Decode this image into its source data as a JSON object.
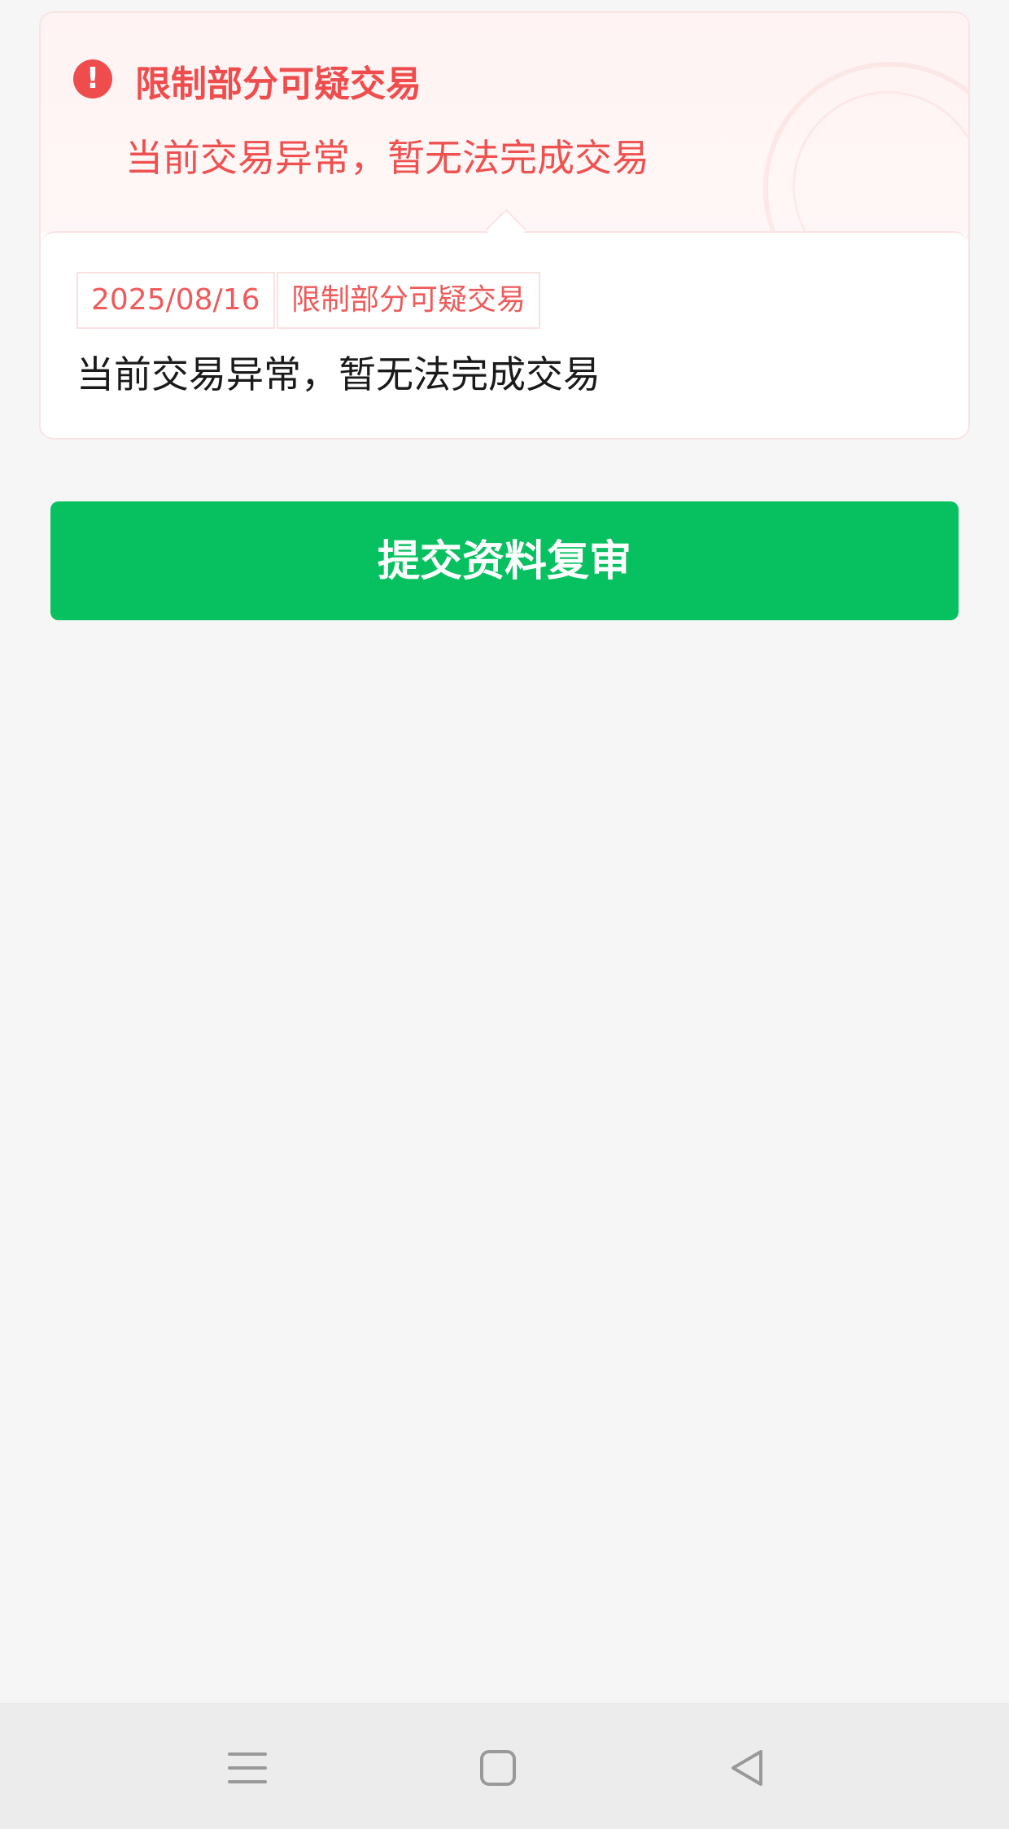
{
  "alert": {
    "icon": "exclamation-circle-icon",
    "icon_glyph": "!",
    "title": "限制部分可疑交易",
    "subtitle": "当前交易异常，暂无法完成交易",
    "accent_color": "#ef4d4d"
  },
  "detail": {
    "date": "2025/08/16",
    "type_tag": "限制部分可疑交易",
    "description": "当前交易异常，暂无法完成交易"
  },
  "actions": {
    "submit_label": "提交资料复审",
    "submit_color": "#07c160"
  },
  "system_nav": {
    "menu_icon": "menu-icon",
    "home_icon": "home-square-icon",
    "back_icon": "back-triangle-icon"
  }
}
